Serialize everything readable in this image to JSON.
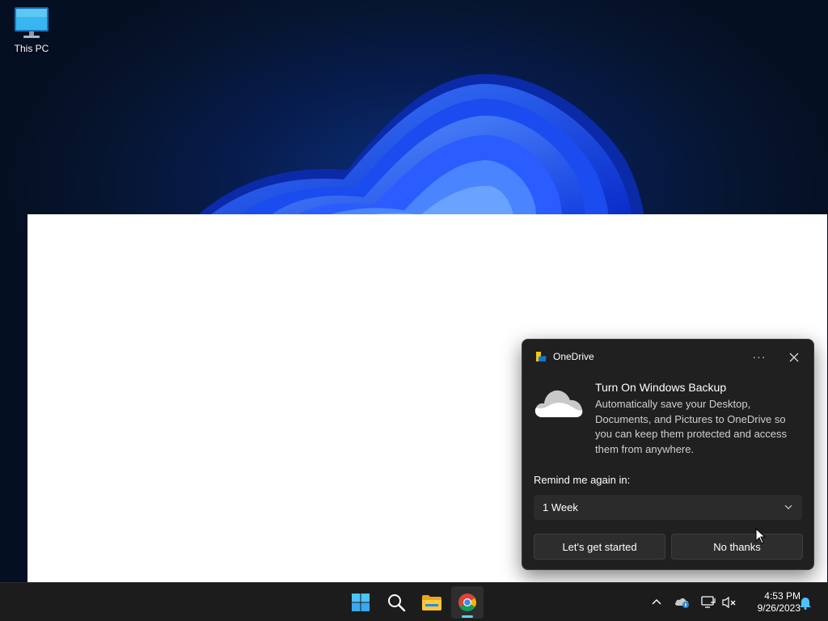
{
  "desktop": {
    "icons": [
      {
        "label": "This PC",
        "icon": "monitor-icon"
      }
    ]
  },
  "toast": {
    "app_name": "OneDrive",
    "title": "Turn On Windows Backup",
    "body": "Automatically save your Desktop, Documents, and Pictures to OneDrive so you can keep them protected and access them from anywhere.",
    "remind_label": "Remind me again in:",
    "remind_value": "1 Week",
    "primary_button": "Let's get started",
    "secondary_button": "No thanks"
  },
  "taskbar": {
    "apps": [
      {
        "name": "Start",
        "icon": "windows-logo-icon"
      },
      {
        "name": "Search",
        "icon": "search-icon"
      },
      {
        "name": "File Explorer",
        "icon": "folder-icon"
      },
      {
        "name": "Google Chrome",
        "icon": "chrome-icon",
        "active": true
      }
    ],
    "tray": [
      "chevron-up-icon",
      "onedrive-icon",
      "network-icon",
      "volume-muted-icon",
      "bell-icon"
    ],
    "time": "4:53 PM",
    "date": "9/26/2023"
  },
  "colors": {
    "accent": "#60cdff",
    "toast_bg": "#202020",
    "taskbar_bg": "#1c1c1c"
  }
}
